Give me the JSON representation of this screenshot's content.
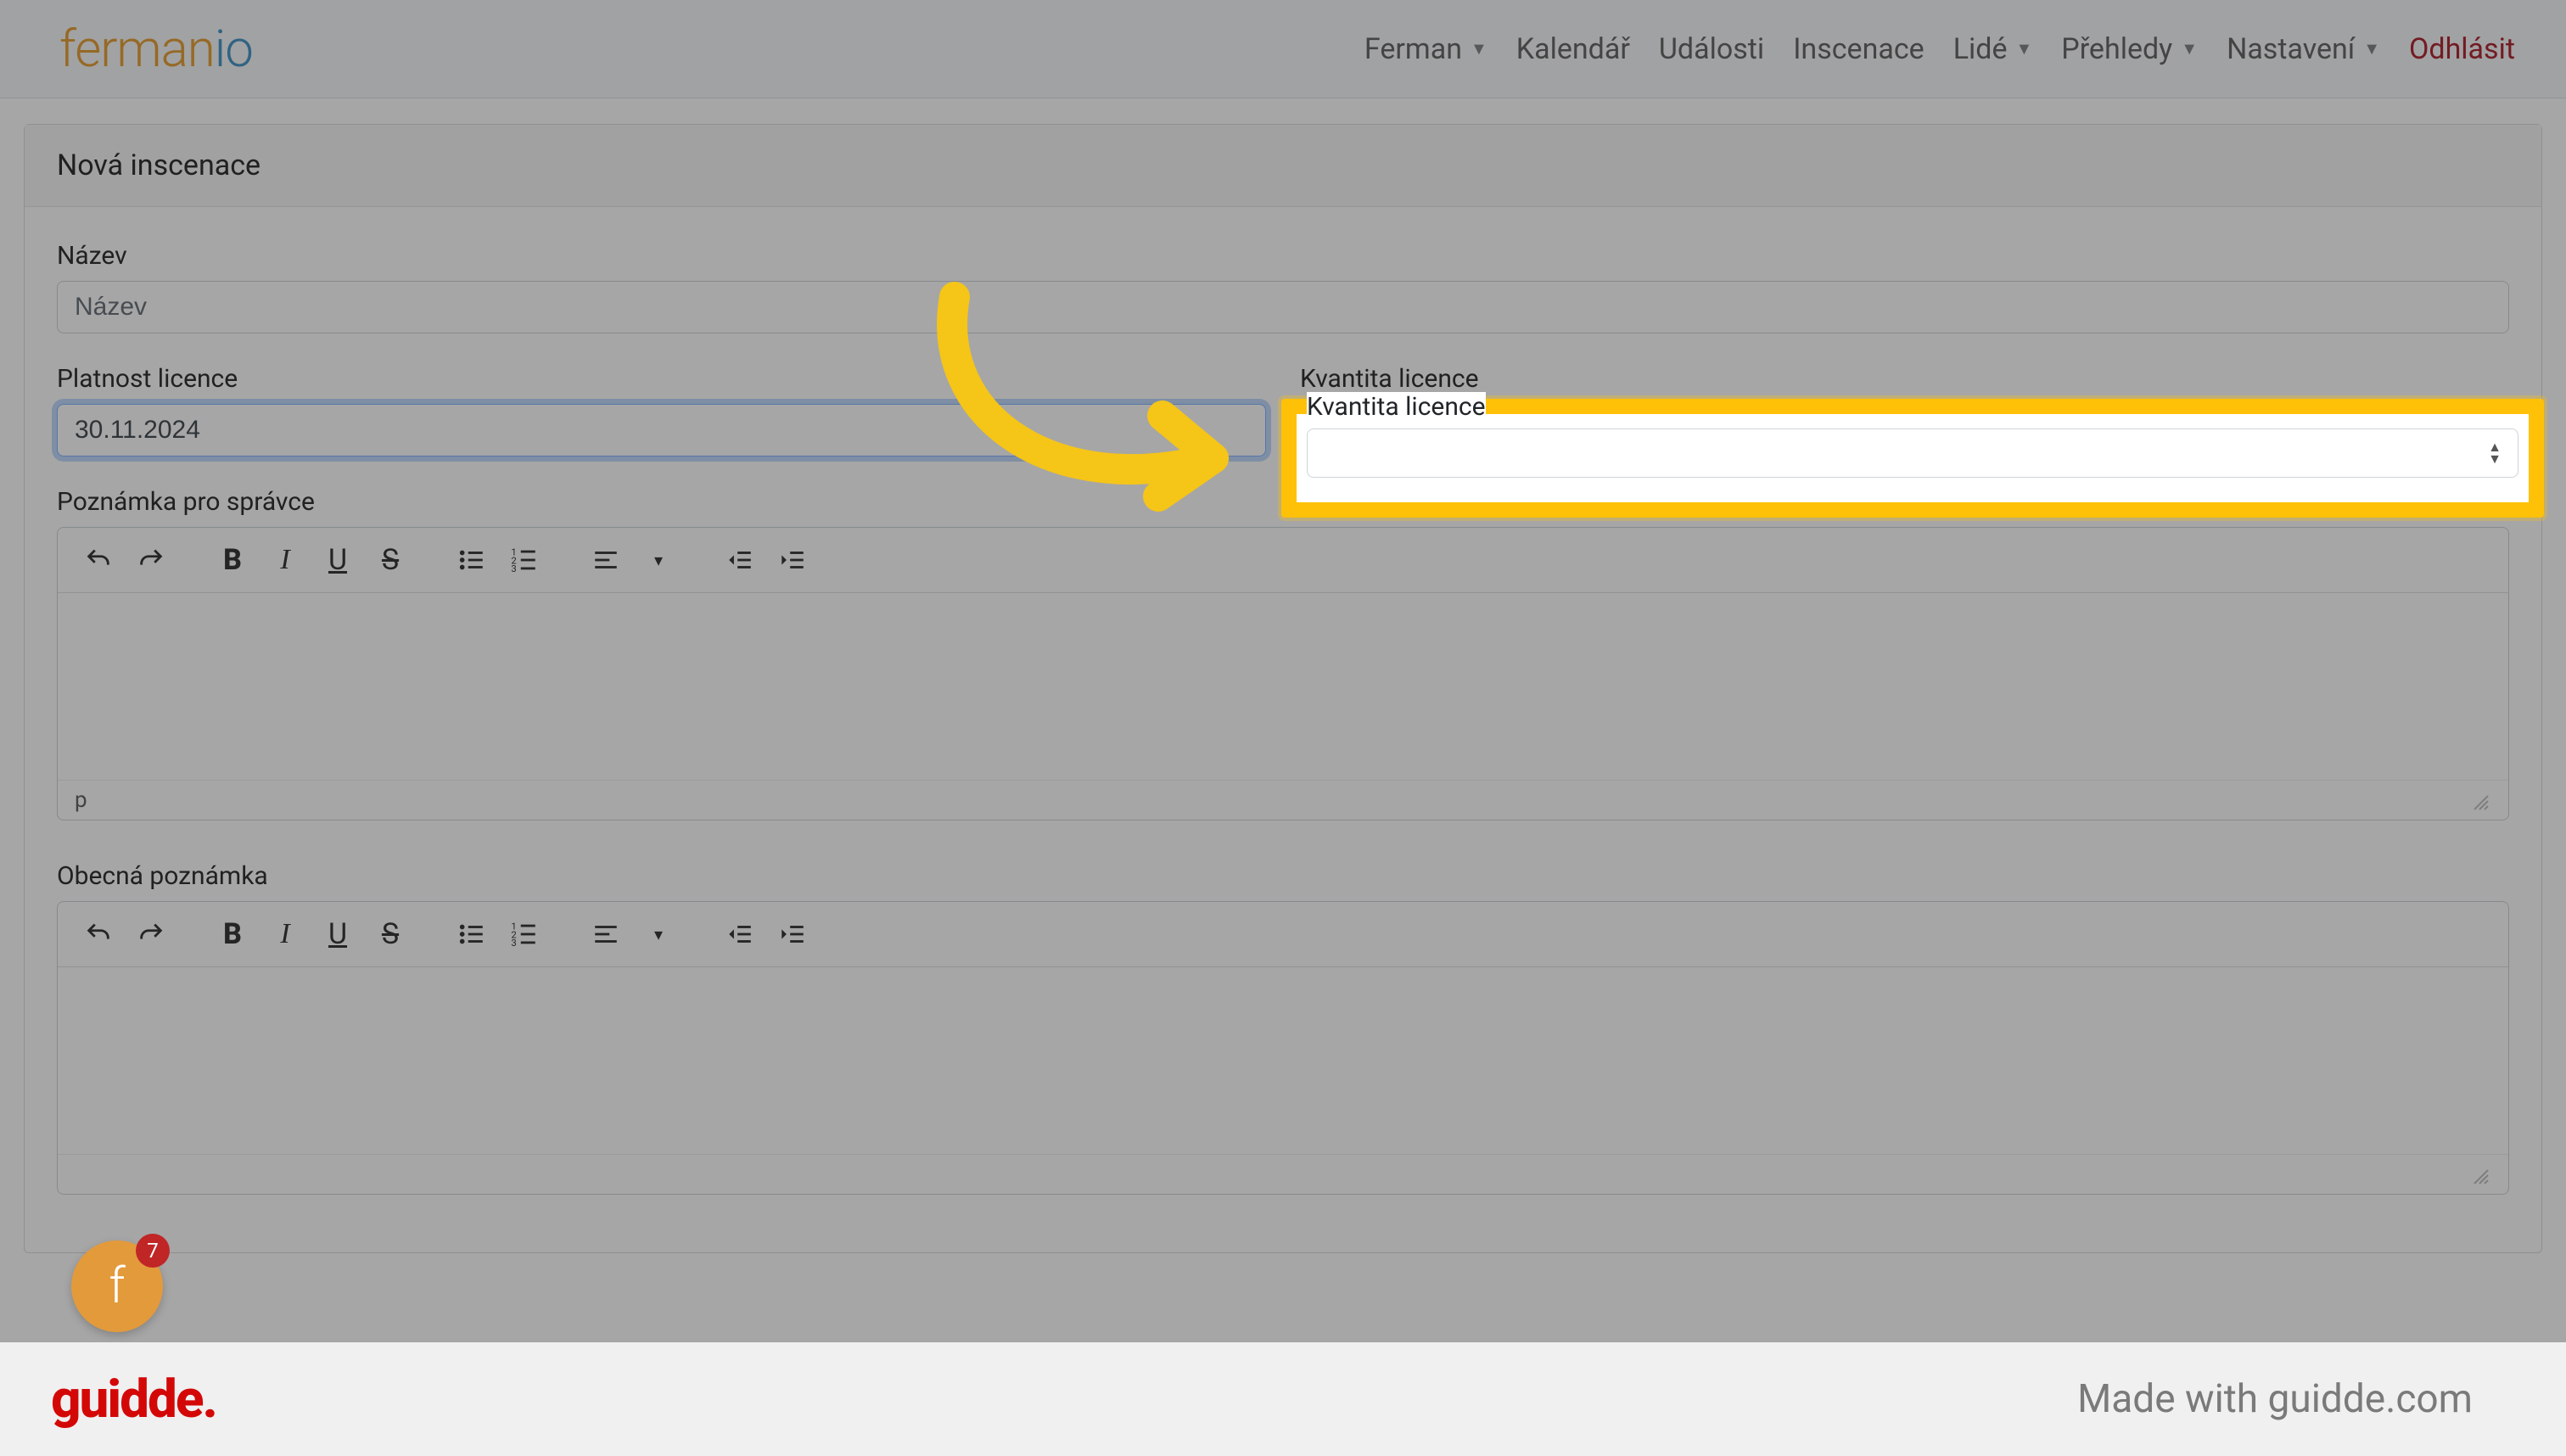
{
  "brand": {
    "part1": "ferman",
    "part2": "io"
  },
  "nav": {
    "items": [
      {
        "label": "Ferman",
        "dropdown": true
      },
      {
        "label": "Kalendář",
        "dropdown": false
      },
      {
        "label": "Události",
        "dropdown": false
      },
      {
        "label": "Inscenace",
        "dropdown": false
      },
      {
        "label": "Lidé",
        "dropdown": true
      },
      {
        "label": "Přehledy",
        "dropdown": true
      },
      {
        "label": "Nastavení",
        "dropdown": true
      }
    ],
    "logout": "Odhlásit"
  },
  "card": {
    "title": "Nová inscenace",
    "fields": {
      "name_label": "Název",
      "name_placeholder": "Název",
      "license_validity_label": "Platnost licence",
      "license_validity_value": "30.11.2024",
      "license_quantity_label": "Kvantita licence",
      "license_quantity_value": "",
      "admin_note_label": "Poznámka pro správce",
      "general_note_label": "Obecná poznámka",
      "status_path": "p"
    }
  },
  "rte_icons": {
    "undo": "undo-icon",
    "redo": "redo-icon",
    "bold": "B",
    "italic": "I",
    "underline": "U",
    "strike": "S",
    "ul": "bullet-list-icon",
    "ol": "numbered-list-icon",
    "align": "align-icon",
    "outdent": "outdent-icon",
    "indent": "indent-icon"
  },
  "chat": {
    "letter": "f",
    "badge": "7"
  },
  "footer": {
    "brand": "guidde.",
    "made_with": "Made with guidde.com"
  },
  "colors": {
    "highlight": "#ffc107",
    "logout": "#b02a37",
    "guidde": "#d40707"
  }
}
